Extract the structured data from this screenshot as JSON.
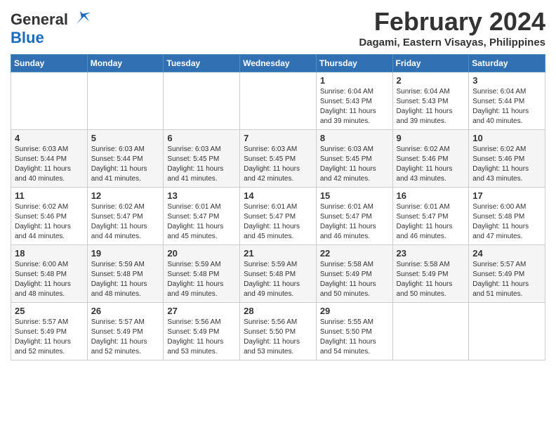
{
  "header": {
    "logo_line1": "General",
    "logo_line2": "Blue",
    "month_title": "February 2024",
    "subtitle": "Dagami, Eastern Visayas, Philippines"
  },
  "days_of_week": [
    "Sunday",
    "Monday",
    "Tuesday",
    "Wednesday",
    "Thursday",
    "Friday",
    "Saturday"
  ],
  "weeks": [
    [
      {
        "day": "",
        "info": ""
      },
      {
        "day": "",
        "info": ""
      },
      {
        "day": "",
        "info": ""
      },
      {
        "day": "",
        "info": ""
      },
      {
        "day": "1",
        "info": "Sunrise: 6:04 AM\nSunset: 5:43 PM\nDaylight: 11 hours\nand 39 minutes."
      },
      {
        "day": "2",
        "info": "Sunrise: 6:04 AM\nSunset: 5:43 PM\nDaylight: 11 hours\nand 39 minutes."
      },
      {
        "day": "3",
        "info": "Sunrise: 6:04 AM\nSunset: 5:44 PM\nDaylight: 11 hours\nand 40 minutes."
      }
    ],
    [
      {
        "day": "4",
        "info": "Sunrise: 6:03 AM\nSunset: 5:44 PM\nDaylight: 11 hours\nand 40 minutes."
      },
      {
        "day": "5",
        "info": "Sunrise: 6:03 AM\nSunset: 5:44 PM\nDaylight: 11 hours\nand 41 minutes."
      },
      {
        "day": "6",
        "info": "Sunrise: 6:03 AM\nSunset: 5:45 PM\nDaylight: 11 hours\nand 41 minutes."
      },
      {
        "day": "7",
        "info": "Sunrise: 6:03 AM\nSunset: 5:45 PM\nDaylight: 11 hours\nand 42 minutes."
      },
      {
        "day": "8",
        "info": "Sunrise: 6:03 AM\nSunset: 5:45 PM\nDaylight: 11 hours\nand 42 minutes."
      },
      {
        "day": "9",
        "info": "Sunrise: 6:02 AM\nSunset: 5:46 PM\nDaylight: 11 hours\nand 43 minutes."
      },
      {
        "day": "10",
        "info": "Sunrise: 6:02 AM\nSunset: 5:46 PM\nDaylight: 11 hours\nand 43 minutes."
      }
    ],
    [
      {
        "day": "11",
        "info": "Sunrise: 6:02 AM\nSunset: 5:46 PM\nDaylight: 11 hours\nand 44 minutes."
      },
      {
        "day": "12",
        "info": "Sunrise: 6:02 AM\nSunset: 5:47 PM\nDaylight: 11 hours\nand 44 minutes."
      },
      {
        "day": "13",
        "info": "Sunrise: 6:01 AM\nSunset: 5:47 PM\nDaylight: 11 hours\nand 45 minutes."
      },
      {
        "day": "14",
        "info": "Sunrise: 6:01 AM\nSunset: 5:47 PM\nDaylight: 11 hours\nand 45 minutes."
      },
      {
        "day": "15",
        "info": "Sunrise: 6:01 AM\nSunset: 5:47 PM\nDaylight: 11 hours\nand 46 minutes."
      },
      {
        "day": "16",
        "info": "Sunrise: 6:01 AM\nSunset: 5:47 PM\nDaylight: 11 hours\nand 46 minutes."
      },
      {
        "day": "17",
        "info": "Sunrise: 6:00 AM\nSunset: 5:48 PM\nDaylight: 11 hours\nand 47 minutes."
      }
    ],
    [
      {
        "day": "18",
        "info": "Sunrise: 6:00 AM\nSunset: 5:48 PM\nDaylight: 11 hours\nand 48 minutes."
      },
      {
        "day": "19",
        "info": "Sunrise: 5:59 AM\nSunset: 5:48 PM\nDaylight: 11 hours\nand 48 minutes."
      },
      {
        "day": "20",
        "info": "Sunrise: 5:59 AM\nSunset: 5:48 PM\nDaylight: 11 hours\nand 49 minutes."
      },
      {
        "day": "21",
        "info": "Sunrise: 5:59 AM\nSunset: 5:48 PM\nDaylight: 11 hours\nand 49 minutes."
      },
      {
        "day": "22",
        "info": "Sunrise: 5:58 AM\nSunset: 5:49 PM\nDaylight: 11 hours\nand 50 minutes."
      },
      {
        "day": "23",
        "info": "Sunrise: 5:58 AM\nSunset: 5:49 PM\nDaylight: 11 hours\nand 50 minutes."
      },
      {
        "day": "24",
        "info": "Sunrise: 5:57 AM\nSunset: 5:49 PM\nDaylight: 11 hours\nand 51 minutes."
      }
    ],
    [
      {
        "day": "25",
        "info": "Sunrise: 5:57 AM\nSunset: 5:49 PM\nDaylight: 11 hours\nand 52 minutes."
      },
      {
        "day": "26",
        "info": "Sunrise: 5:57 AM\nSunset: 5:49 PM\nDaylight: 11 hours\nand 52 minutes."
      },
      {
        "day": "27",
        "info": "Sunrise: 5:56 AM\nSunset: 5:49 PM\nDaylight: 11 hours\nand 53 minutes."
      },
      {
        "day": "28",
        "info": "Sunrise: 5:56 AM\nSunset: 5:50 PM\nDaylight: 11 hours\nand 53 minutes."
      },
      {
        "day": "29",
        "info": "Sunrise: 5:55 AM\nSunset: 5:50 PM\nDaylight: 11 hours\nand 54 minutes."
      },
      {
        "day": "",
        "info": ""
      },
      {
        "day": "",
        "info": ""
      }
    ]
  ]
}
